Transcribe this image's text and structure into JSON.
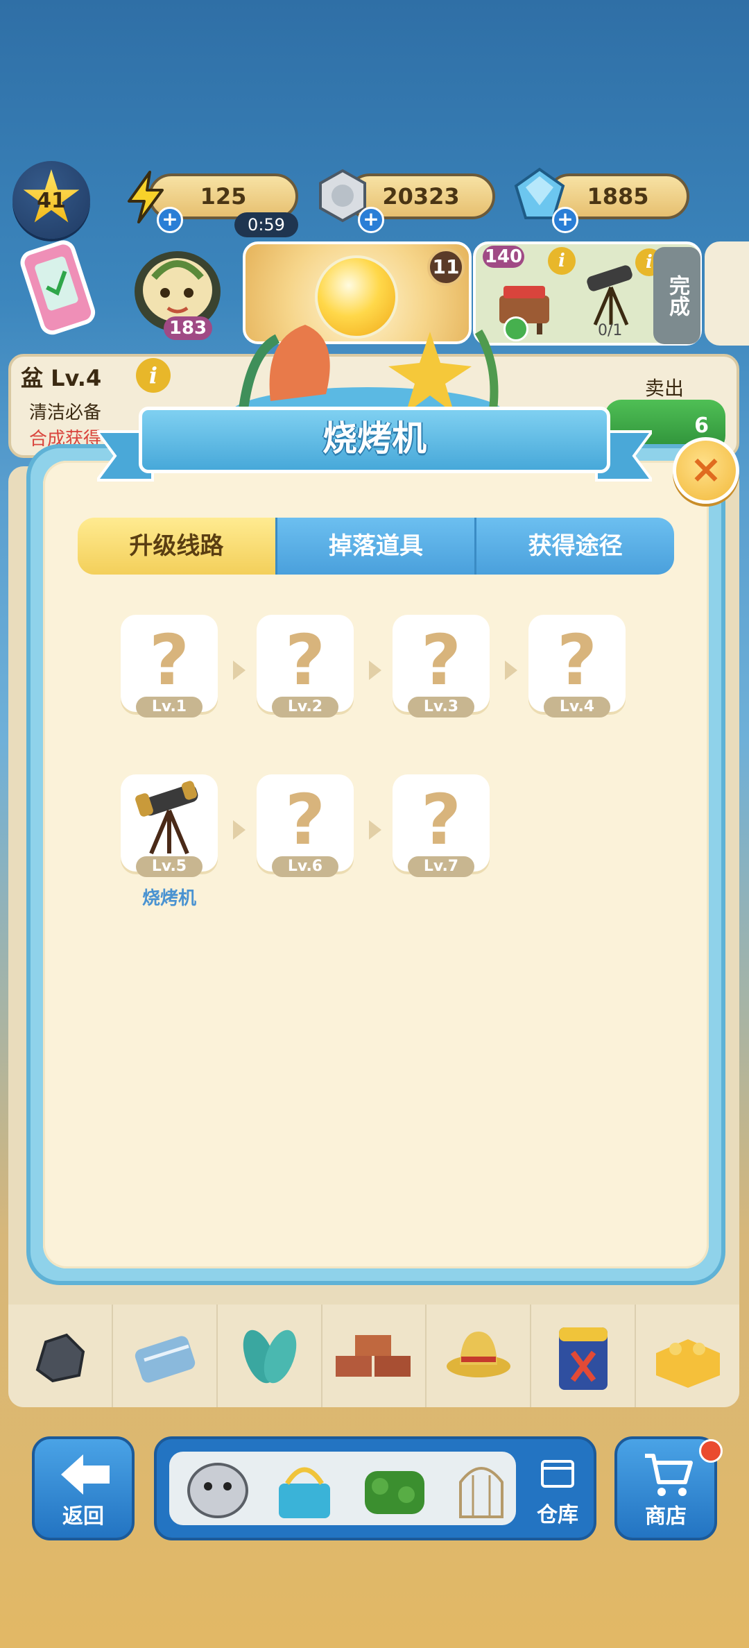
{
  "hud": {
    "player_level": "41",
    "energy": "125",
    "energy_timer": "0:59",
    "coins": "20323",
    "gems": "1885",
    "plus": "+"
  },
  "order_badge": "183",
  "gacha_count": "11",
  "task": {
    "badge": "140",
    "progress": "0/1",
    "done_label": "完成"
  },
  "item_info": {
    "title": "盆 Lv.4",
    "desc": "清洁必备",
    "source": "合成获得",
    "sell_label": "卖出",
    "sell_value": "6"
  },
  "modal": {
    "title": "烧烤机",
    "close": "×",
    "tabs": [
      {
        "label": "升级线路",
        "active": true
      },
      {
        "label": "掉落道具",
        "active": false
      },
      {
        "label": "获得途径",
        "active": false
      }
    ],
    "unknown_mark": "?",
    "levels": [
      {
        "tag": "Lv.1",
        "unlocked": false
      },
      {
        "tag": "Lv.2",
        "unlocked": false
      },
      {
        "tag": "Lv.3",
        "unlocked": false
      },
      {
        "tag": "Lv.4",
        "unlocked": false
      },
      {
        "tag": "Lv.5",
        "unlocked": true,
        "name": "烧烤机",
        "icon": "telescope-icon"
      },
      {
        "tag": "Lv.6",
        "unlocked": false
      },
      {
        "tag": "Lv.7",
        "unlocked": false
      }
    ]
  },
  "bottom_items": [
    "rock-icon",
    "towel-icon",
    "leaf-wings-icon",
    "bricks-icon",
    "sun-hat-icon",
    "paint-can-icon",
    "toy-brick-icon"
  ],
  "nav": {
    "back": "返回",
    "storage": "仓库",
    "shop": "商店"
  },
  "colors": {
    "tab_active": "#f3cf5a",
    "tab_inactive": "#4aa0dc",
    "modal_frame": "#8fd2ea",
    "modal_bg": "#fbf2d9",
    "level_name": "#4a93d1"
  }
}
